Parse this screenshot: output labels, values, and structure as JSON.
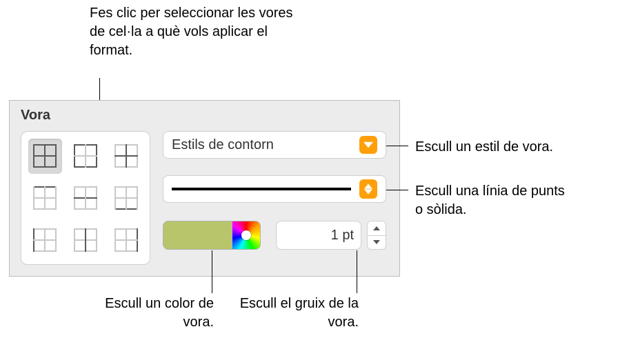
{
  "callouts": {
    "edgeSelect": "Fes clic per seleccionar les vores de cel·la a què vols aplicar el format.",
    "style": "Escull un estil de vora.",
    "line": "Escull una línia de punts o sòlida.",
    "color": "Escull un color de vora.",
    "weight": "Escull el gruix de la vora."
  },
  "panel": {
    "title": "Vora",
    "outlineStyleLabel": "Estils de contorn",
    "borderColor": "#b8c56a",
    "weightValue": "1 pt"
  }
}
